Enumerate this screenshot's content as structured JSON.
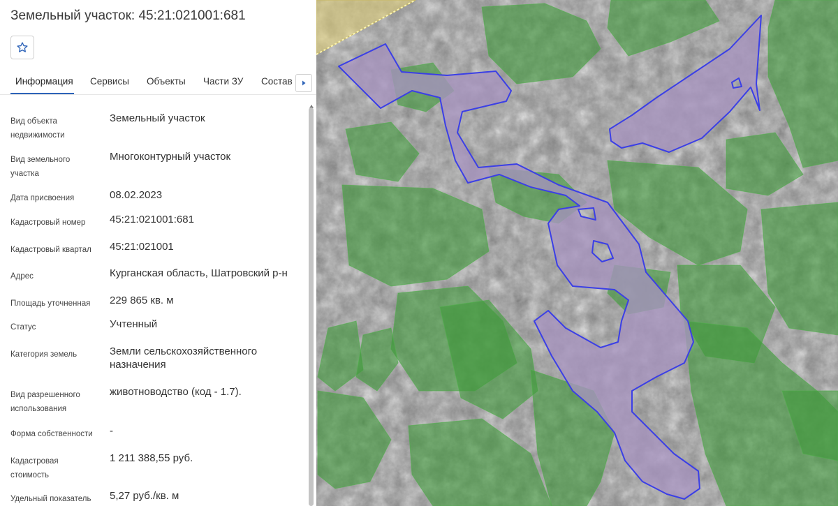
{
  "header": {
    "title": "Земельный участок: 45:21:021001:681"
  },
  "tabs": [
    {
      "label": "Информация"
    },
    {
      "label": "Сервисы"
    },
    {
      "label": "Объекты"
    },
    {
      "label": "Части ЗУ"
    },
    {
      "label": "Состав"
    }
  ],
  "info": [
    {
      "label": "Вид объекта недвижимости",
      "value": "Земельный участок"
    },
    {
      "label": "Вид земельного участка",
      "value": "Многоконтурный участок"
    },
    {
      "label": "Дата присвоения",
      "value": "08.02.2023"
    },
    {
      "label": "Кадастровый номер",
      "value": "45:21:021001:681"
    },
    {
      "label": "Кадастровый квартал",
      "value": "45:21:021001"
    },
    {
      "label": "Адрес",
      "value": "Курганская область, Шатровский р-н"
    },
    {
      "label": "Площадь уточненная",
      "value": "229 865 кв. м"
    },
    {
      "label": "Статус",
      "value": "Учтенный"
    },
    {
      "label": "Категория земель",
      "value": "Земли сельскохозяйственного назначения"
    },
    {
      "label": "Вид разрешенного использования",
      "value": "животноводство (код - 1.7)."
    },
    {
      "label": "Форма собственности",
      "value": "-"
    },
    {
      "label": "Кадастровая стоимость",
      "value": "1 211 388,55 руб."
    },
    {
      "label": "Удельный показатель",
      "value": "5,27 руб./кв. м"
    }
  ],
  "icons": {
    "favorite": "star-outline-icon",
    "tabs_next": "chevron-right-icon"
  },
  "colors": {
    "accent": "#2d63b8",
    "parcel_fill": "#a793bf",
    "parcel_outline": "#3b3fe6",
    "forest_overlay": "#3f9a3a",
    "zone_overlay": "#e0cf7a"
  }
}
